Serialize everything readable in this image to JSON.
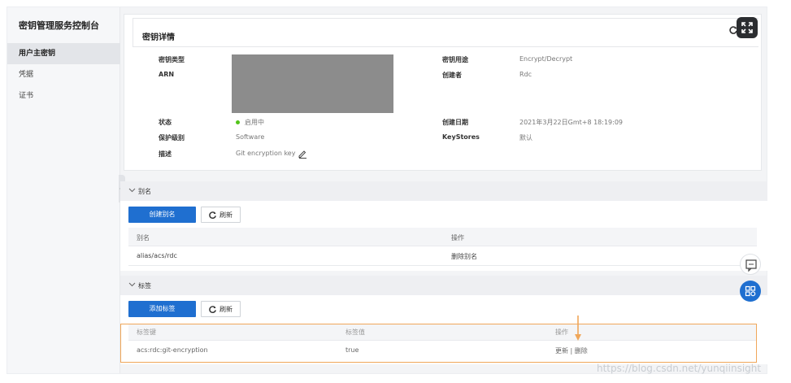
{
  "sidebar": {
    "title": "密钥管理服务控制台",
    "items": [
      {
        "label": "用户主密钥",
        "active": true
      },
      {
        "label": "凭据",
        "active": false
      },
      {
        "label": "证书",
        "active": false
      }
    ]
  },
  "details": {
    "title": "密钥详情",
    "left": [
      {
        "label": "密钥类型",
        "value": ""
      },
      {
        "label": "ARN",
        "value": ""
      },
      {
        "label": "状态",
        "value": "启用中"
      },
      {
        "label": "保护级别",
        "value": "Software"
      },
      {
        "label": "描述",
        "value": "Git encryption key"
      }
    ],
    "right": [
      {
        "label": "密钥用途",
        "value": "Encrypt/Decrypt"
      },
      {
        "label": "创建者",
        "value": "Rdc"
      },
      {
        "label": "创建日期",
        "value": "2021年3月22日Gmt+8 18:19:09"
      },
      {
        "label": "KeyStores",
        "value": "默认"
      }
    ]
  },
  "alias_section": {
    "title": "别名",
    "create_label": "创建别名",
    "refresh_label": "刷新",
    "columns": [
      "别名",
      "操作"
    ],
    "rows": [
      {
        "alias": "alias/acs/rdc",
        "action": "删除别名"
      }
    ]
  },
  "tag_section": {
    "title": "标签",
    "add_label": "添加标签",
    "refresh_label": "刷新",
    "columns": [
      "标签键",
      "标签值",
      "操作"
    ],
    "rows": [
      {
        "key": "acs:rdc:git-encryption",
        "value": "true",
        "update": "更新",
        "separator": "|",
        "delete": "删除"
      }
    ]
  },
  "watermark": "https://blog.csdn.net/yunqiinsight",
  "colors": {
    "primary": "#1f6fd0",
    "status_ok": "#52c41a",
    "highlight": "#f0a75a"
  }
}
